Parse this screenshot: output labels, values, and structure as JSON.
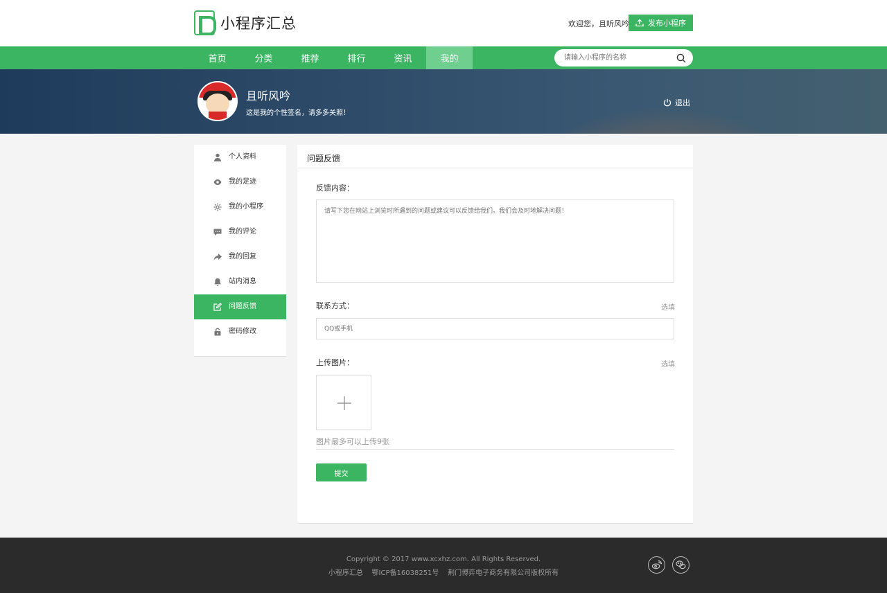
{
  "brand": {
    "logo_text": "小程序汇总"
  },
  "header": {
    "welcome": "欢迎您，且听风吟",
    "publish_label": "发布小程序"
  },
  "nav": {
    "items": [
      {
        "label": "首页"
      },
      {
        "label": "分类"
      },
      {
        "label": "推荐"
      },
      {
        "label": "排行"
      },
      {
        "label": "资讯"
      },
      {
        "label": "我的",
        "active": true
      }
    ]
  },
  "search": {
    "placeholder": "请输入小程序的名称"
  },
  "profile": {
    "username": "且听风吟",
    "signature": "这是我的个性签名，请多多关照！",
    "logout_label": "退出"
  },
  "sidebar": {
    "items": [
      {
        "label": "个人资料",
        "icon": "user-icon"
      },
      {
        "label": "我的足迹",
        "icon": "eye-icon"
      },
      {
        "label": "我的小程序",
        "icon": "gear-icon"
      },
      {
        "label": "我的评论",
        "icon": "comment-icon"
      },
      {
        "label": "我的回复",
        "icon": "reply-icon"
      },
      {
        "label": "站内消息",
        "icon": "bell-icon"
      },
      {
        "label": "问题反馈",
        "icon": "edit-icon",
        "active": true
      },
      {
        "label": "密码修改",
        "icon": "lock-icon"
      }
    ]
  },
  "feedback": {
    "title": "问题反馈",
    "content_label": "反馈内容：",
    "content_placeholder": "请写下您在网站上浏览时所遇到的问题或建议可以反馈给我们。我们会及时地解决问题！",
    "contact_label": "联系方式：",
    "contact_optional": "选填",
    "contact_placeholder": "QQ或手机",
    "image_label": "上传图片：",
    "image_optional": "选填",
    "image_hint": "图片最多可以上传9张",
    "submit_label": "提交"
  },
  "footer": {
    "copyright": "Copyright © 2017 www.xcxhz.com. All Rights Reserved.",
    "icp": "小程序汇总    鄂ICP备16038251号    荆门博弈电子商务有限公司版权所有"
  },
  "colors": {
    "accent": "#3cb562",
    "nav_active": "#6fcf8f",
    "footer": "#2b2b2b"
  }
}
